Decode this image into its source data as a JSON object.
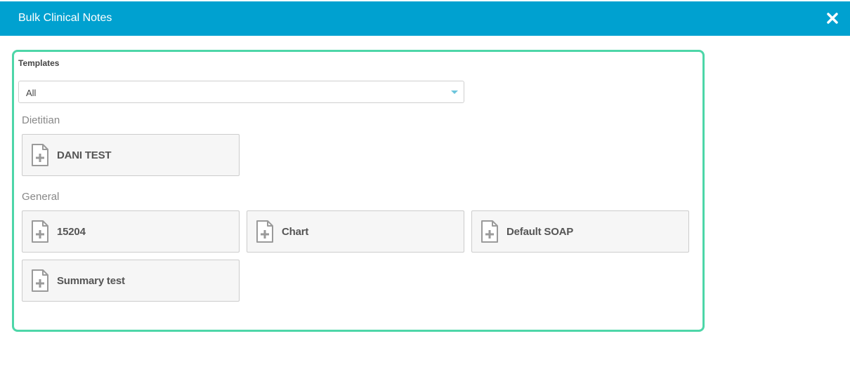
{
  "dialog": {
    "title": "Bulk Clinical Notes",
    "close_icon": "close-icon"
  },
  "templates": {
    "label": "Templates",
    "filter_value": "All"
  },
  "groups": [
    {
      "name": "Dietitian",
      "items": [
        {
          "label": "DANI TEST",
          "icon": "note-add-icon"
        }
      ]
    },
    {
      "name": "General",
      "items": [
        {
          "label": "15204",
          "icon": "note-add-icon"
        },
        {
          "label": "Chart",
          "icon": "note-add-icon"
        },
        {
          "label": "Default SOAP",
          "icon": "note-add-icon"
        },
        {
          "label": "Summary test",
          "icon": "note-add-icon"
        }
      ]
    }
  ],
  "colors": {
    "header": "#00a1d0",
    "panel_border": "#4dd6a8",
    "card_bg": "#f6f6f6",
    "icon": "#9a9a9a"
  }
}
